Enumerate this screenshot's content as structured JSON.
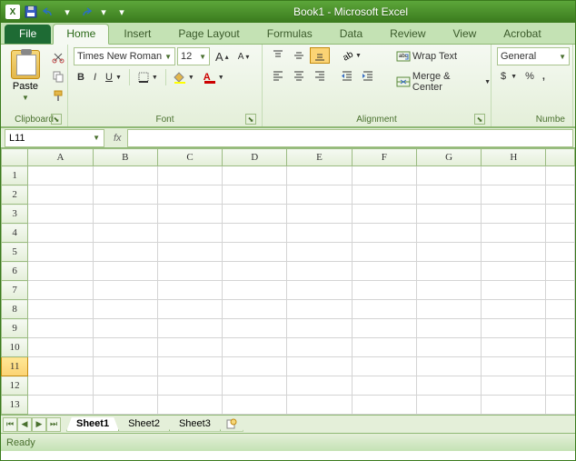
{
  "title": "Book1  -  Microsoft Excel",
  "tabs": {
    "file": "File",
    "list": [
      "Home",
      "Insert",
      "Page Layout",
      "Formulas",
      "Data",
      "Review",
      "View",
      "Acrobat"
    ],
    "active": "Home"
  },
  "clipboard": {
    "label": "Clipboard",
    "paste": "Paste"
  },
  "font": {
    "label": "Font",
    "name": "Times New Roman",
    "size": "12",
    "growA": "A",
    "shrinkA": "A",
    "bold": "B",
    "italic": "I",
    "underline": "U"
  },
  "alignment": {
    "label": "Alignment",
    "wrap": "Wrap Text",
    "merge": "Merge & Center"
  },
  "number": {
    "label": "Numbe",
    "format": "General",
    "currency": "$",
    "percent": "%",
    "comma": ","
  },
  "namebox_value": "L11",
  "fx": "fx",
  "columns": [
    "A",
    "B",
    "C",
    "D",
    "E",
    "F",
    "G",
    "H"
  ],
  "rows": [
    "1",
    "2",
    "3",
    "4",
    "5",
    "6",
    "7",
    "8",
    "9",
    "10",
    "11",
    "12",
    "13"
  ],
  "selected_row": "11",
  "sheets": {
    "list": [
      "Sheet1",
      "Sheet2",
      "Sheet3"
    ],
    "active": "Sheet1"
  },
  "status": "Ready"
}
